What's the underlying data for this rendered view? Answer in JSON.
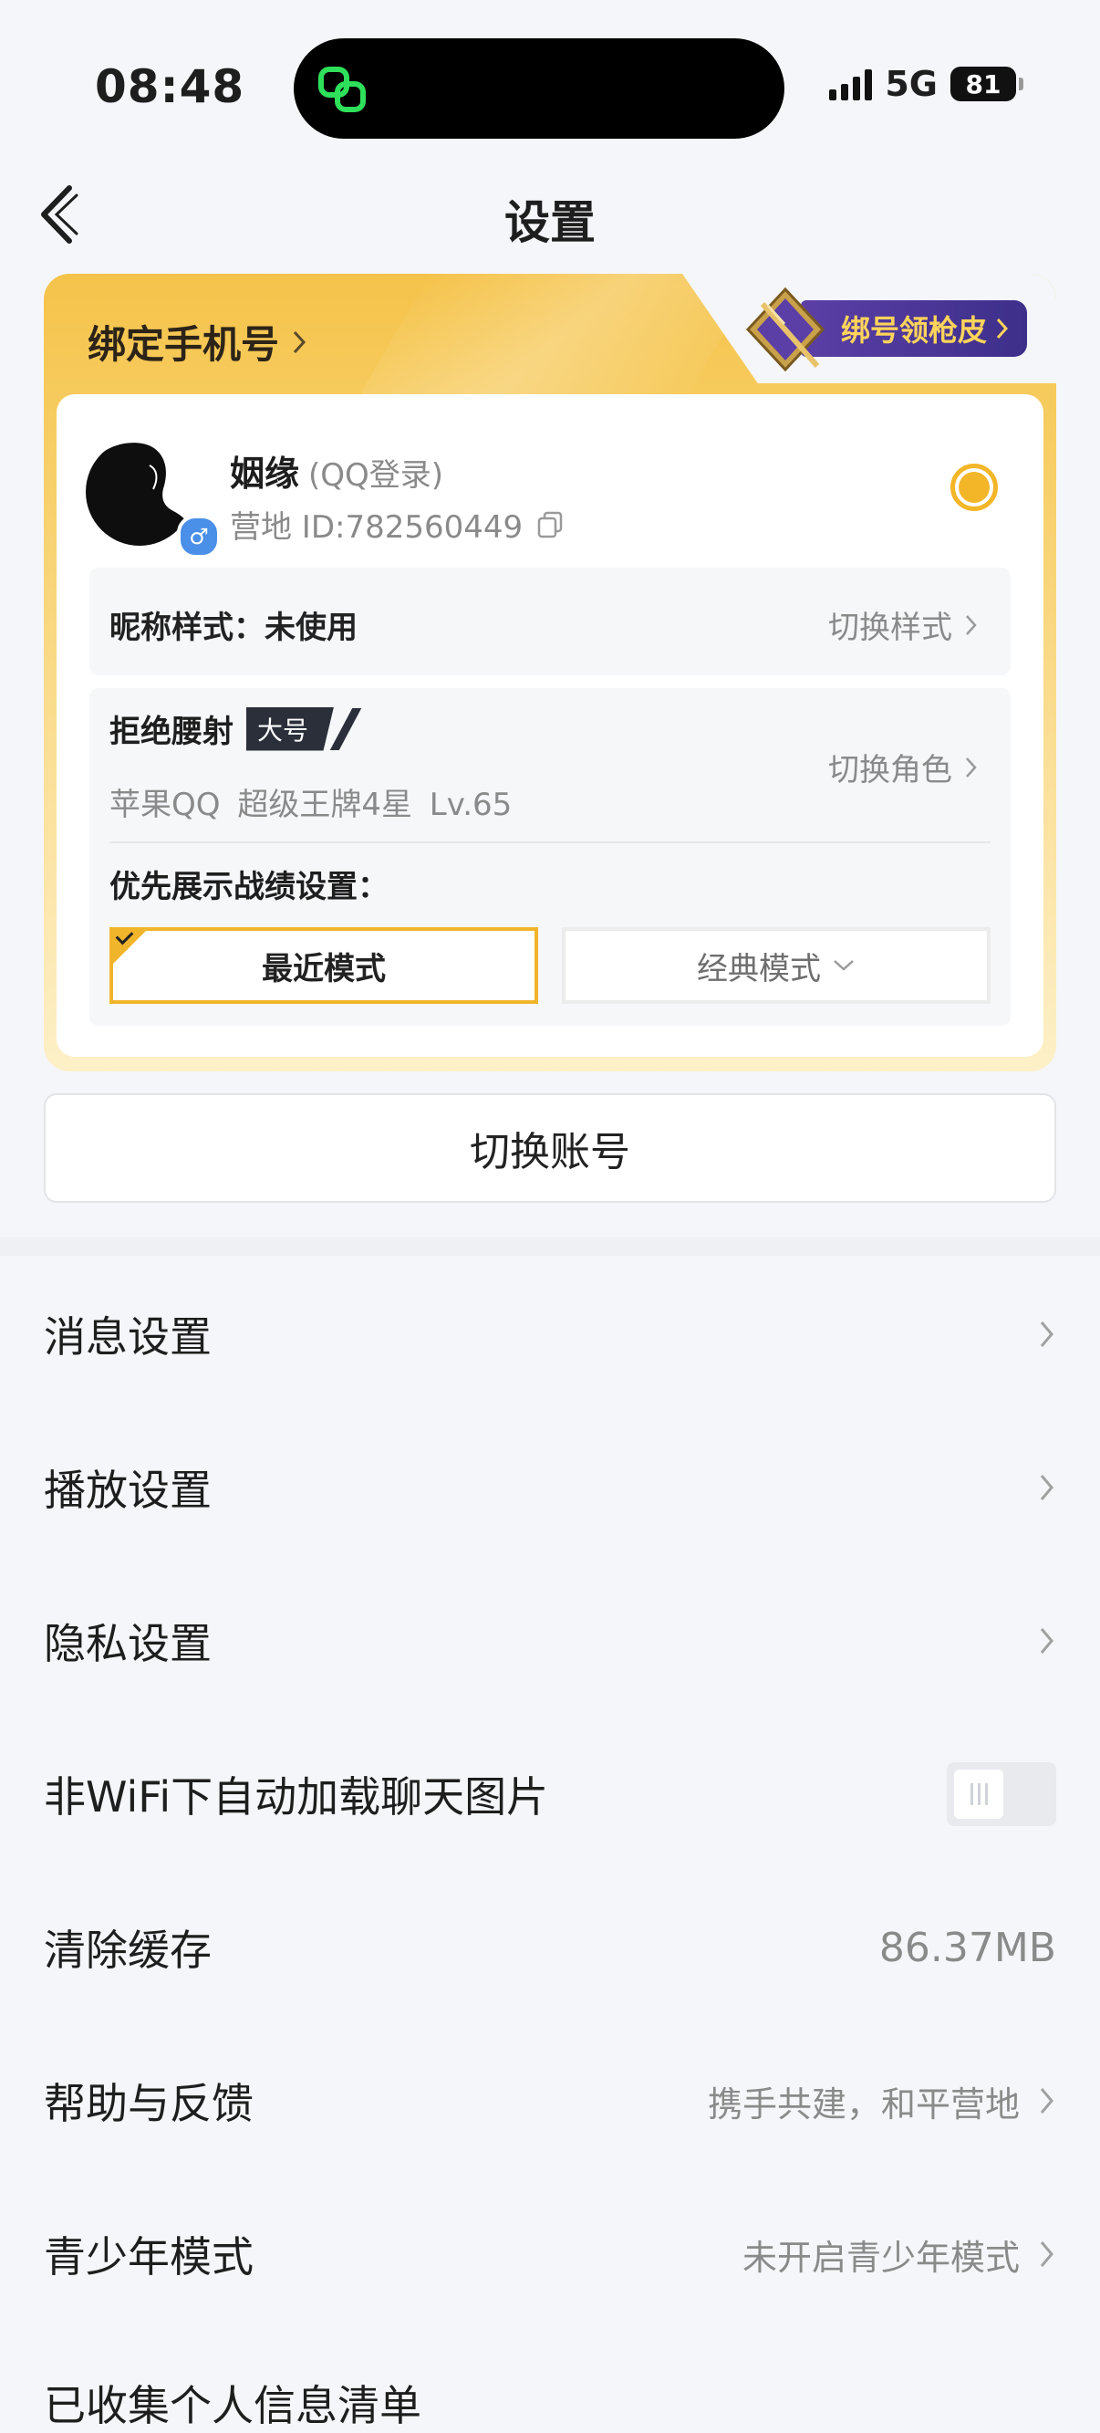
{
  "status_bar": {
    "time": "08:48",
    "network": "5G",
    "battery": "81"
  },
  "nav": {
    "title": "设置"
  },
  "account_card": {
    "bind_phone_label": "绑定手机号",
    "bind_skin_label": "绑号领枪皮",
    "user": {
      "name": "姻缘",
      "login_type": "(QQ登录)",
      "id_text": "营地 ID:782560449"
    },
    "nickname_style": {
      "label": "昵称样式：未使用",
      "action": "切换样式"
    },
    "role": {
      "name": "拒绝腰射",
      "badge": "大号",
      "subtitle": "苹果QQ  超级王牌4星  Lv.65",
      "action": "切换角色"
    },
    "priority": {
      "label": "优先展示战绩设置：",
      "modes": [
        "最近模式",
        "经典模式"
      ],
      "selected": "最近模式"
    }
  },
  "switch_account_label": "切换账号",
  "settings": [
    {
      "label": "消息设置"
    },
    {
      "label": "播放设置"
    },
    {
      "label": "隐私设置"
    },
    {
      "label": "非WiFi下自动加载聊天图片",
      "toggle": false
    },
    {
      "label": "清除缓存",
      "value": "86.37MB"
    },
    {
      "label": "帮助与反馈",
      "value": "携手共建，和平营地"
    },
    {
      "label": "青少年模式",
      "value": "未开启青少年模式"
    },
    {
      "label": "已收集个人信息清单"
    }
  ],
  "colors": {
    "accent": "#f3b628",
    "badge_bg": "#2a2f3a",
    "skin_pill": "#4a36a0",
    "island_logo": "#2ee05a"
  }
}
